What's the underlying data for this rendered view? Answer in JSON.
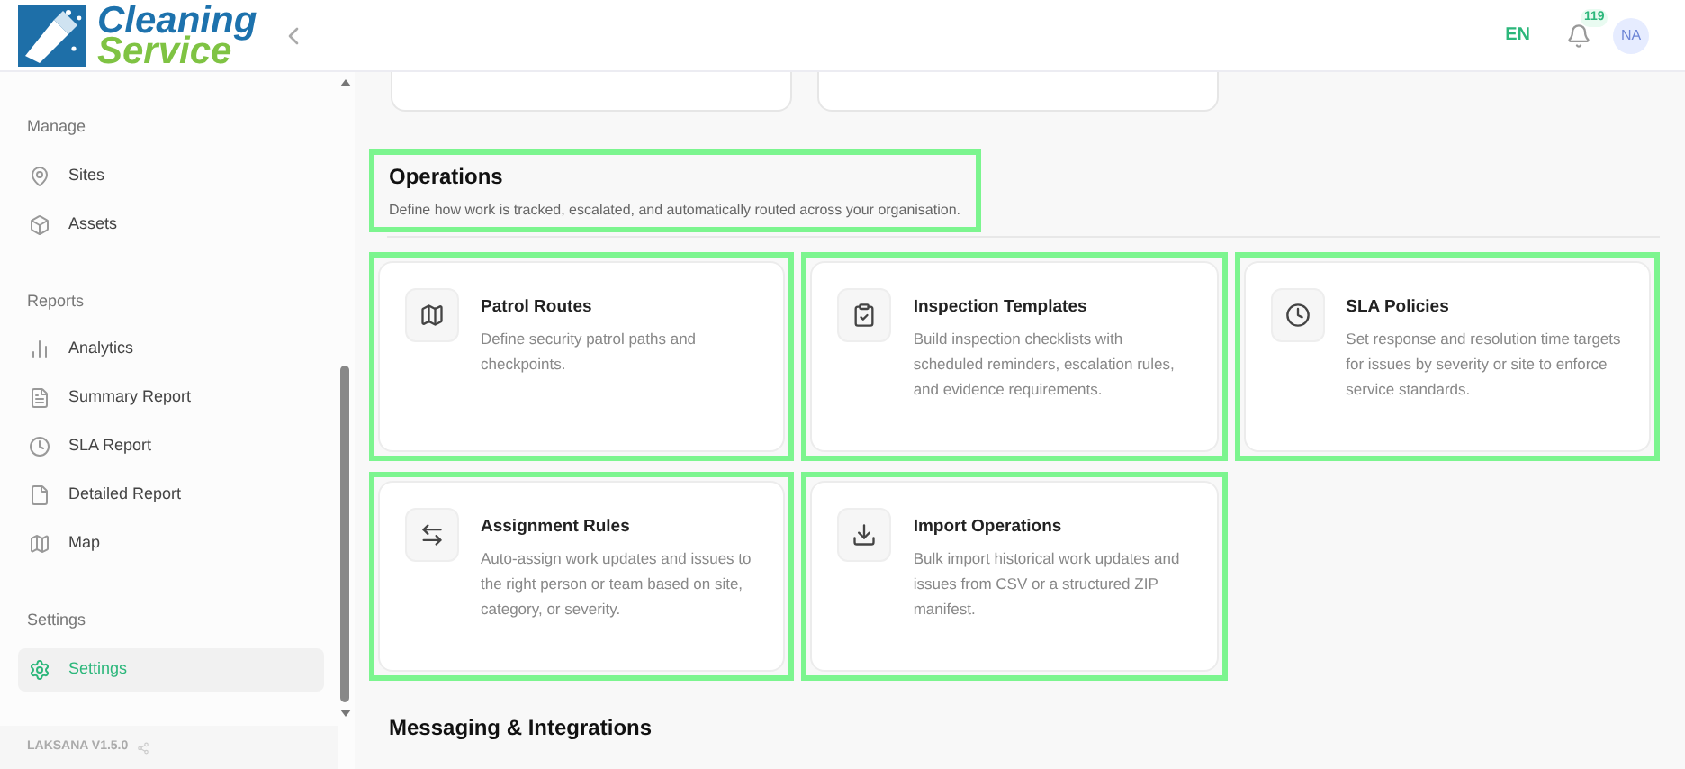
{
  "header": {
    "logo_line_1": "Cleaning",
    "logo_line_2": "Service",
    "language": "EN",
    "notification_count": "119",
    "avatar": "NA"
  },
  "sidebar": {
    "sections": [
      {
        "label": "Manage",
        "items": [
          {
            "label": "Sites",
            "selected": false
          },
          {
            "label": "Assets",
            "selected": false
          }
        ]
      },
      {
        "label": "Reports",
        "items": [
          {
            "label": "Analytics",
            "selected": false
          },
          {
            "label": "Summary Report",
            "selected": false
          },
          {
            "label": "SLA Report",
            "selected": false
          },
          {
            "label": "Detailed Report",
            "selected": false
          },
          {
            "label": "Map",
            "selected": false
          }
        ]
      },
      {
        "label": "Settings",
        "items": [
          {
            "label": "Settings",
            "selected": true
          }
        ]
      }
    ],
    "version": "LAKSANA V1.5.0"
  },
  "sections": [
    {
      "title": "Operations",
      "description": "Define how work is tracked, escalated, and automatically routed across your organisation.",
      "highlighted": true,
      "cards": [
        {
          "title": "Patrol Routes",
          "description": "Define security patrol paths and checkpoints.",
          "highlighted": true
        },
        {
          "title": "Inspection Templates",
          "description": "Build inspection checklists with scheduled reminders, escalation rules, and evidence requirements.",
          "highlighted": true
        },
        {
          "title": "SLA Policies",
          "description": "Set response and resolution time targets for issues by severity or site to enforce service standards.",
          "highlighted": true
        },
        {
          "title": "Assignment Rules",
          "description": "Auto-assign work updates and issues to the right person or team based on site, category, or severity.",
          "highlighted": true
        },
        {
          "title": "Import Operations",
          "description": "Bulk import historical work updates and issues from CSV or a structured ZIP manifest.",
          "highlighted": true
        }
      ]
    },
    {
      "title": "Messaging & Integrations",
      "highlighted": false
    }
  ]
}
